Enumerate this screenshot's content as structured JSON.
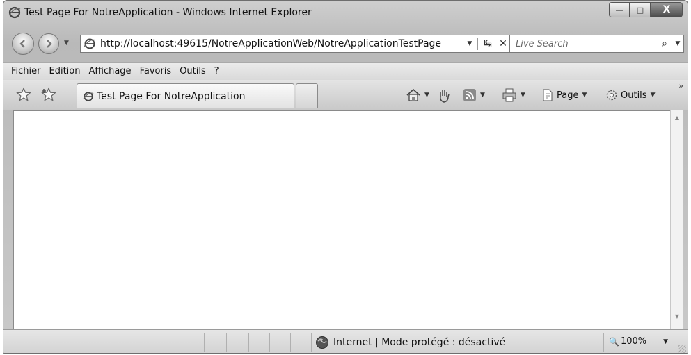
{
  "window": {
    "title": "Test Page For NotreApplication - Windows Internet Explorer",
    "caption_buttons": {
      "minimize": "—",
      "maximize": "□",
      "close": "X"
    }
  },
  "address_bar": {
    "url": "http://localhost:49615/NotreApplicationWeb/NotreApplicationTestPage",
    "dropdown_glyph": "▼",
    "refresh_glyph": "↹",
    "stop_glyph": "✕"
  },
  "search": {
    "placeholder": "Live Search",
    "search_glyph": "⌕",
    "dropdown_glyph": "▼"
  },
  "menu": {
    "items": [
      "Fichier",
      "Edition",
      "Affichage",
      "Favoris",
      "Outils",
      "?"
    ]
  },
  "tabs": {
    "active_label": "Test Page For NotreApplication"
  },
  "commands": {
    "page_label": "Page",
    "tools_label": "Outils",
    "overflow": "»",
    "dropdown_glyph": "▼"
  },
  "status": {
    "zone_text": "Internet | Mode protégé : désactivé",
    "zoom_text": "100%",
    "zoom_icon": "🔍",
    "dropdown_glyph": "▼"
  },
  "scrollbar": {
    "up_glyph": "▲",
    "down_glyph": "▼"
  },
  "icons": {
    "back": "back-arrow-icon",
    "forward": "forward-arrow-icon",
    "favorites": "star-icon",
    "add_favorites": "add-star-icon",
    "home": "home-icon",
    "research": "hand-icon",
    "feeds": "rss-icon",
    "print": "printer-icon",
    "page": "page-icon",
    "tools": "gear-icon",
    "zone": "globe-icon"
  }
}
